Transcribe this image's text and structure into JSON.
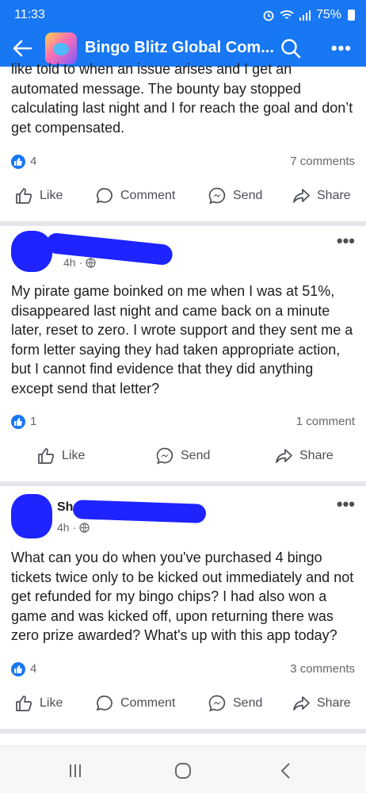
{
  "status": {
    "time": "11:33",
    "battery": "75%"
  },
  "appbar": {
    "title": "Bingo Blitz Global Com..."
  },
  "posts": [
    {
      "partial_top_line": "like told to when an issue arises and I get an",
      "text": "automated message. The bounty bay stopped calculating last night and I for reach the goal and don’t get compensated.",
      "reactions": "4",
      "comments": "7 comments"
    },
    {
      "name": "",
      "time": "4h",
      "text": "My pirate game boinked on me when I was at 51%, disappeared last night and came back on a minute later, reset to zero. I wrote support and they sent me a form letter saying they had taken appropriate action, but I cannot find evidence that they did anything except send that letter?",
      "reactions": "1",
      "comments": "1 comment"
    },
    {
      "name": "Sh",
      "time": "4h",
      "text": "What can you do when you've purchased 4 bingo tickets twice only to be kicked out immediately and not get refunded for my bingo chips? I had also won a game and was kicked off, upon returning there was zero prize awarded? What's up with this app today?",
      "reactions": "4",
      "comments": "3 comments"
    }
  ],
  "actions": {
    "like": "Like",
    "comment": "Comment",
    "send": "Send",
    "share": "Share"
  },
  "colors": {
    "brand": "#1877f2",
    "redaction": "#1d24ff"
  },
  "icons": [
    "back-arrow-icon",
    "search-icon",
    "more-icon",
    "like-icon",
    "comment-icon",
    "messenger-icon",
    "share-icon",
    "globe-icon"
  ]
}
